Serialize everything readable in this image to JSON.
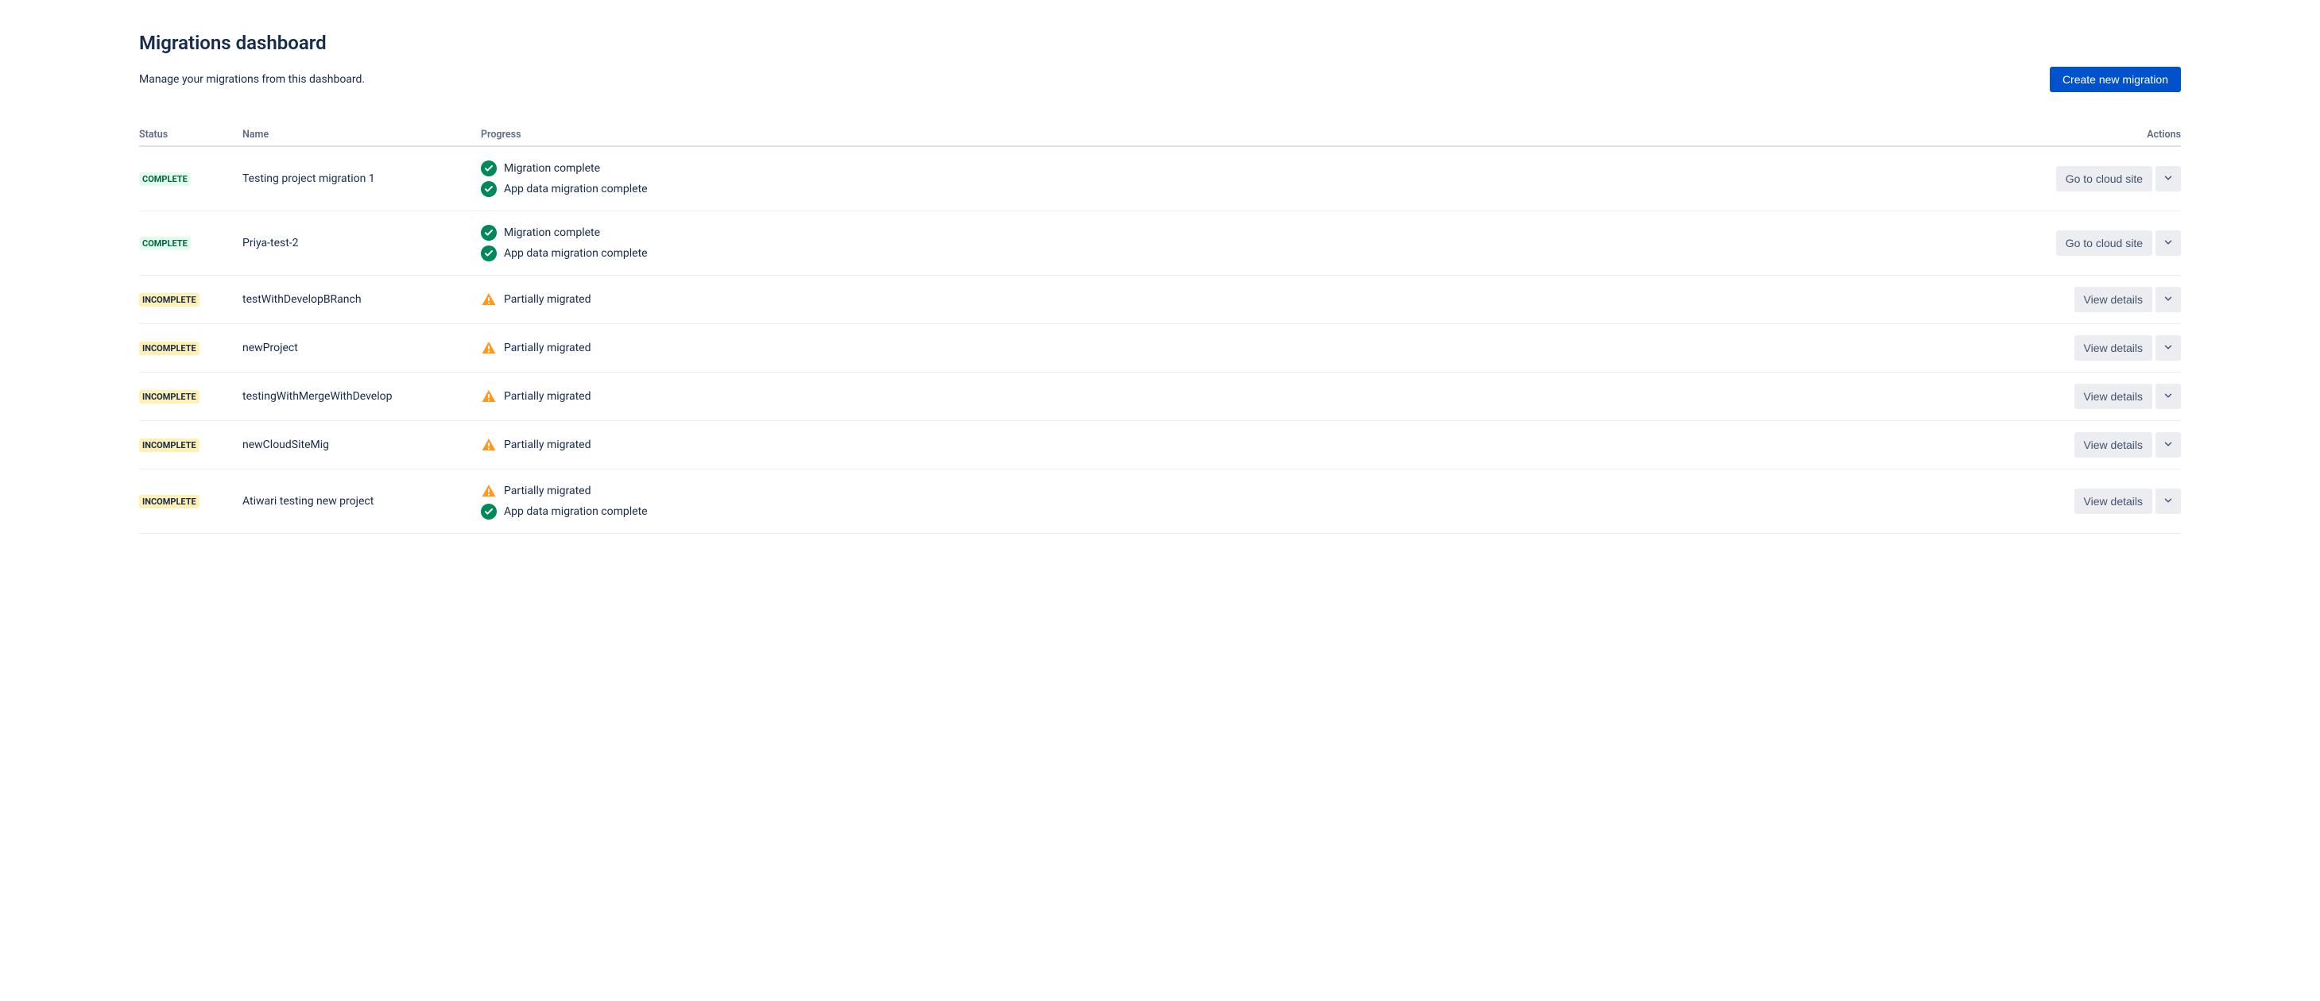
{
  "header": {
    "title": "Migrations dashboard",
    "subtitle": "Manage your migrations from this dashboard.",
    "create_button": "Create new migration"
  },
  "columns": {
    "status": "Status",
    "name": "Name",
    "progress": "Progress",
    "actions": "Actions"
  },
  "status_labels": {
    "complete": "COMPLETE",
    "incomplete": "INCOMPLETE"
  },
  "action_labels": {
    "go_cloud": "Go to cloud site",
    "view_details": "View details"
  },
  "progress_messages": {
    "migration_complete": "Migration complete",
    "app_data_complete": "App data migration complete",
    "partially_migrated": "Partially migrated"
  },
  "rows": [
    {
      "status": "complete",
      "name": "Testing project migration 1",
      "progress": [
        [
          "check",
          "migration_complete"
        ],
        [
          "check",
          "app_data_complete"
        ]
      ],
      "action": "go_cloud"
    },
    {
      "status": "complete",
      "name": "Priya-test-2",
      "progress": [
        [
          "check",
          "migration_complete"
        ],
        [
          "check",
          "app_data_complete"
        ]
      ],
      "action": "go_cloud"
    },
    {
      "status": "incomplete",
      "name": "testWithDevelopBRanch",
      "progress": [
        [
          "warn",
          "partially_migrated"
        ]
      ],
      "action": "view_details"
    },
    {
      "status": "incomplete",
      "name": "newProject",
      "progress": [
        [
          "warn",
          "partially_migrated"
        ]
      ],
      "action": "view_details"
    },
    {
      "status": "incomplete",
      "name": "testingWithMergeWithDevelop",
      "progress": [
        [
          "warn",
          "partially_migrated"
        ]
      ],
      "action": "view_details"
    },
    {
      "status": "incomplete",
      "name": "newCloudSiteMig",
      "progress": [
        [
          "warn",
          "partially_migrated"
        ]
      ],
      "action": "view_details"
    },
    {
      "status": "incomplete",
      "name": "Atiwari testing new project",
      "progress": [
        [
          "warn",
          "partially_migrated"
        ],
        [
          "check",
          "app_data_complete"
        ]
      ],
      "action": "view_details"
    }
  ]
}
